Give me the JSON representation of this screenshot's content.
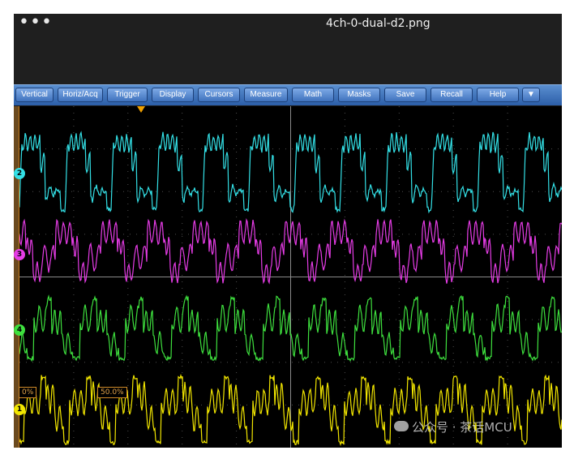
{
  "window": {
    "title": "4ch-0-dual-d2.png",
    "dots": "•••"
  },
  "menu": {
    "items": [
      "Vertical",
      "Horiz/Acq",
      "Trigger",
      "Display",
      "Cursors",
      "Measure",
      "Math",
      "Masks",
      "Save",
      "Recall",
      "Help",
      "▼"
    ]
  },
  "channels": [
    {
      "label": "2",
      "color": "#33e0e6"
    },
    {
      "label": "3",
      "color": "#e63ce6"
    },
    {
      "label": "4",
      "color": "#3ee03e"
    },
    {
      "label": "1",
      "color": "#f2e600"
    }
  ],
  "reference": {
    "left": "0%",
    "right": "50.0%"
  },
  "watermark": "公众号 · 茶话MCU",
  "colors": {
    "menubar": "#2c5ea8",
    "grid": "#707070",
    "trigger": "#f0a000"
  }
}
